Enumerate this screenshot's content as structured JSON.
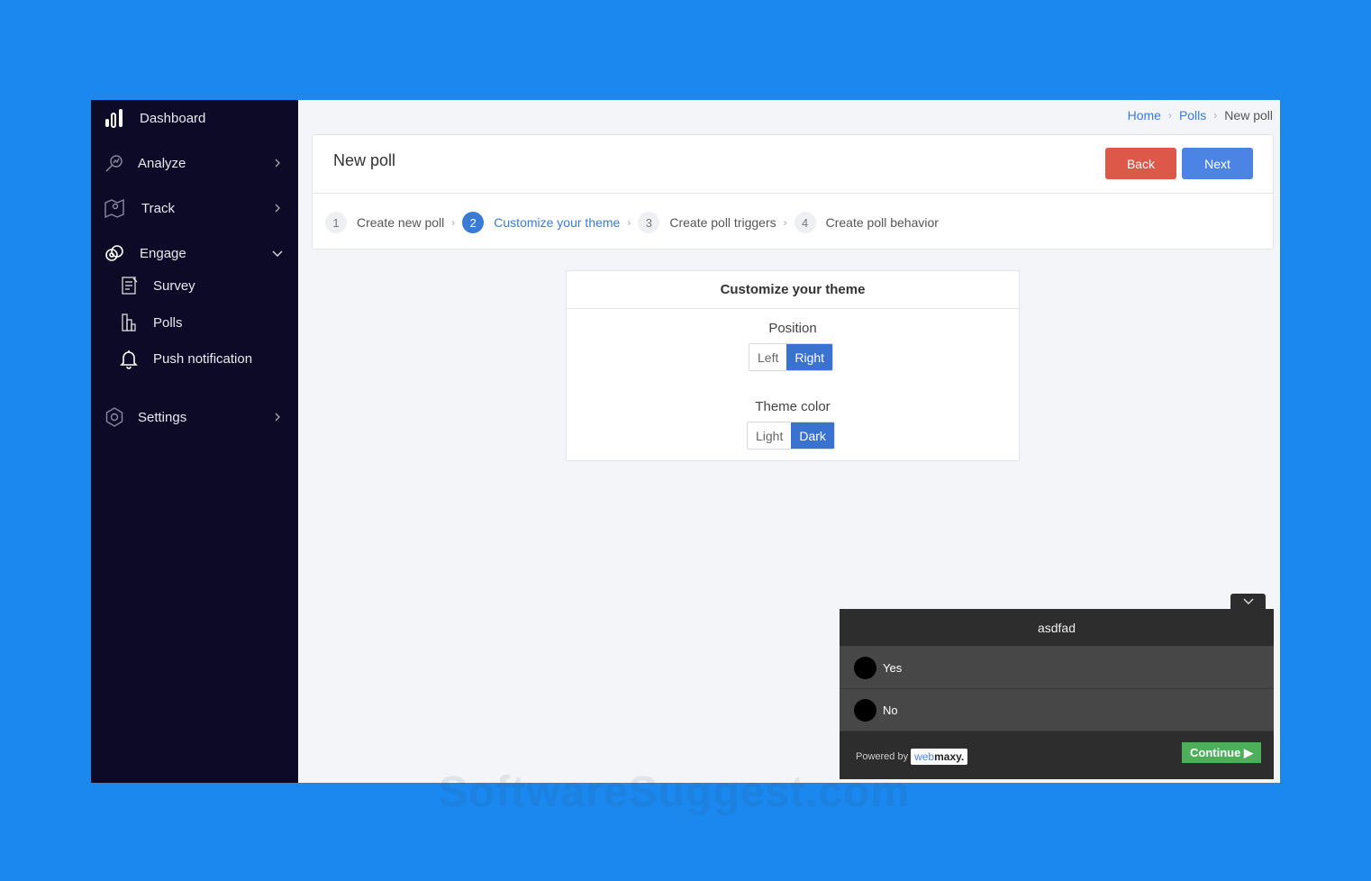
{
  "sidebar": {
    "dashboard": "Dashboard",
    "analyze": "Analyze",
    "track": "Track",
    "engage": "Engage",
    "survey": "Survey",
    "polls": "Polls",
    "push": "Push notification",
    "settings": "Settings"
  },
  "breadcrumb": {
    "home": "Home",
    "polls": "Polls",
    "current": "New poll"
  },
  "header": {
    "title": "New poll",
    "back": "Back",
    "next": "Next"
  },
  "steps": [
    {
      "num": "1",
      "label": "Create new poll"
    },
    {
      "num": "2",
      "label": "Customize your theme"
    },
    {
      "num": "3",
      "label": "Create poll triggers"
    },
    {
      "num": "4",
      "label": "Create poll behavior"
    }
  ],
  "theme": {
    "title": "Customize your theme",
    "position_label": "Position",
    "position_left": "Left",
    "position_right": "Right",
    "position_selected": "Right",
    "color_label": "Theme color",
    "color_light": "Light",
    "color_dark": "Dark",
    "color_selected": "Dark"
  },
  "poll": {
    "question": "asdfad",
    "options": [
      "Yes",
      "No"
    ],
    "powered_by": "Powered by",
    "brand_a": "web",
    "brand_b": "maxy.",
    "continue": "Continue ▶"
  },
  "watermark": "SoftwareSuggest.com",
  "colors": {
    "accent": "#3a7bd5",
    "danger": "#dd5849",
    "sidebar": "#0d0a27",
    "success": "#4cb05a",
    "background": "#1a88ee"
  }
}
